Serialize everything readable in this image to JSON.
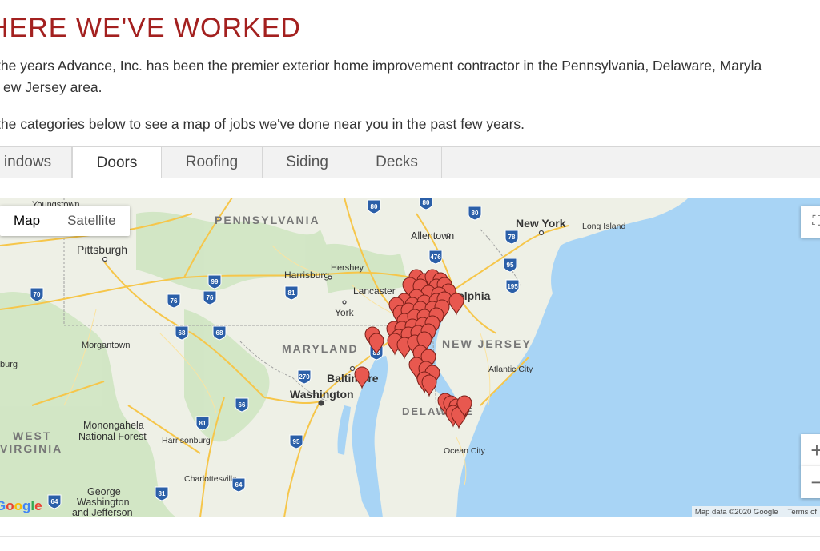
{
  "heading": "HERE WE'VE WORKED",
  "intro": {
    "line1": "the years Advance, Inc. has been the premier exterior home improvement contractor in the Pennsylvania, Delaware, Maryla",
    "line2": "ew Jersey area.",
    "line3": "the categories below to see a map of jobs we've done near you in the past few years."
  },
  "tabs": [
    {
      "label": "indows",
      "active": false
    },
    {
      "label": "Doors",
      "active": true
    },
    {
      "label": "Roofing",
      "active": false
    },
    {
      "label": "Siding",
      "active": false
    },
    {
      "label": "Decks",
      "active": false
    }
  ],
  "map": {
    "type_buttons": {
      "map": "Map",
      "satellite": "Satellite"
    },
    "zoom_in": "+",
    "zoom_out": "−",
    "attribution": {
      "data": "Map data ©2020 Google",
      "terms": "Terms of"
    },
    "logo": "Google",
    "colors": {
      "water": "#a8d4f5",
      "land": "#eef0e6",
      "forest": "#cfe6c2",
      "highway": "#f6c64a",
      "marker": "#e8584f"
    },
    "labels": {
      "pennsylvania": "PENNSYLVANIA",
      "maryland": "MARYLAND",
      "new_jersey": "NEW JERSEY",
      "delaware": "DELAWARE",
      "west_virginia_1": "WEST",
      "west_virginia_2": "VIRGINIA",
      "pittsburgh": "Pittsburgh",
      "youngstown": "Youngstown",
      "allentown": "Allentown",
      "new_york": "New York",
      "long_island": "Long Island",
      "hershey": "Hershey",
      "harrisburg": "Harrisburg",
      "lancaster": "Lancaster",
      "york": "York",
      "philadelphia": "elphia",
      "morgantown": "Morgantown",
      "baltimore": "Baltimore",
      "washington": "Washington",
      "atlantic_city": "Atlantic City",
      "ocean_city": "Ocean City",
      "monongahela_1": "Monongahela",
      "monongahela_2": "National Forest",
      "harrisonburg": "Harrisonburg",
      "charlottesville": "Charlottesville",
      "george_1": "George",
      "george_2": "Washington",
      "george_3": "and Jefferson",
      "burg": "burg"
    },
    "shields": [
      "80",
      "80",
      "80",
      "78",
      "476",
      "95",
      "195",
      "99",
      "76",
      "70",
      "76",
      "81",
      "68",
      "68",
      "83",
      "270",
      "95",
      "66",
      "81",
      "64",
      "64",
      "81"
    ]
  }
}
